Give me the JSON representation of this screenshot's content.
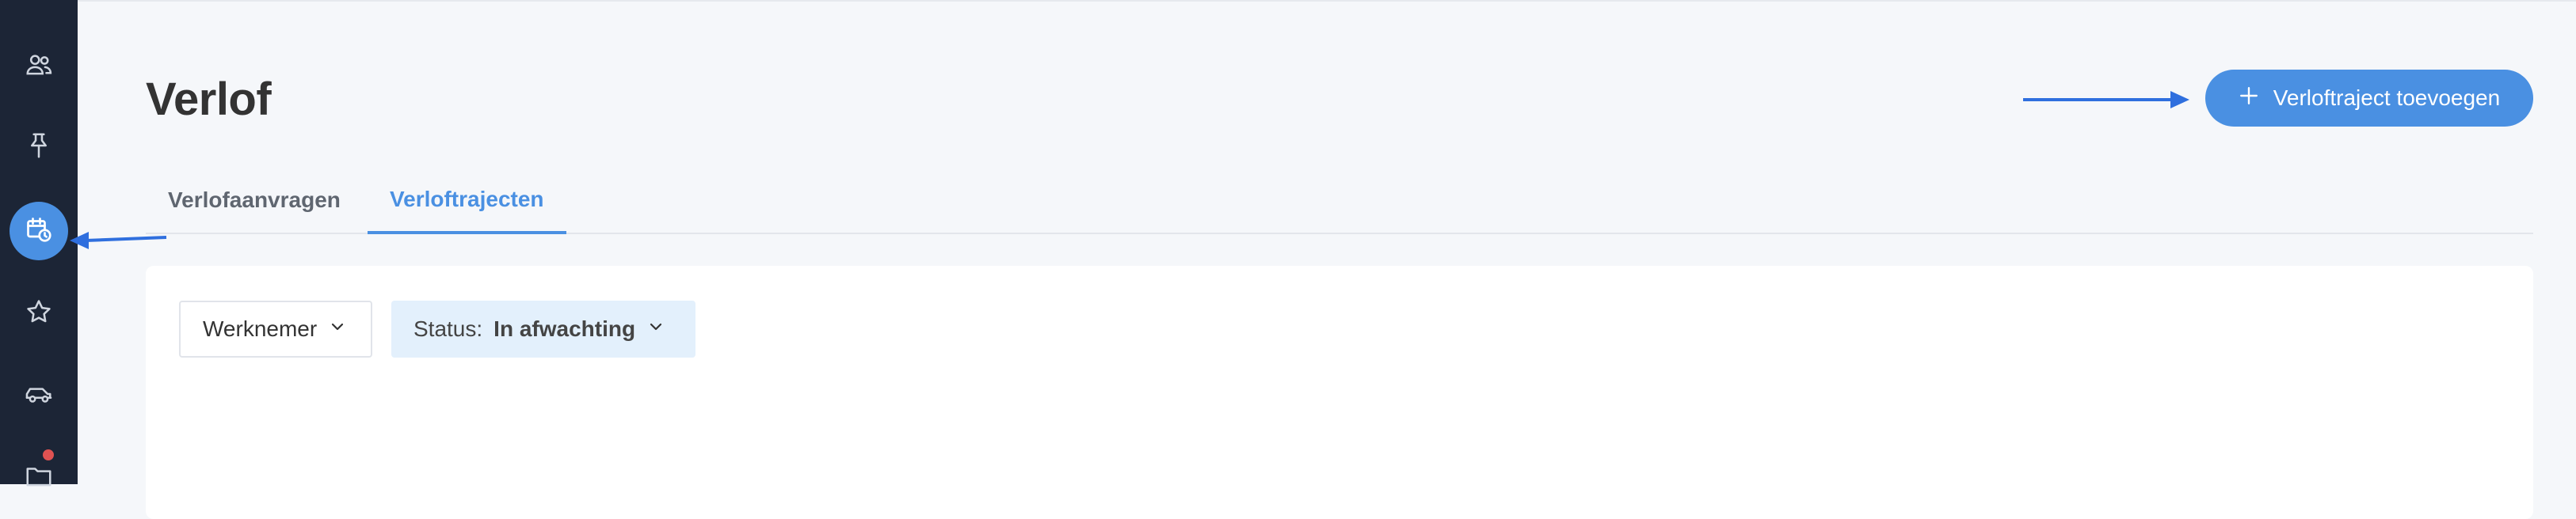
{
  "page": {
    "title": "Verlof"
  },
  "actions": {
    "add_button_label": "Verloftraject toevoegen"
  },
  "tabs": [
    {
      "label": "Verlofaanvragen",
      "active": false
    },
    {
      "label": "Verloftrajecten",
      "active": true
    }
  ],
  "filters": {
    "employee": {
      "label": "Werknemer"
    },
    "status": {
      "label": "Status:",
      "value": "In afwachting"
    }
  },
  "sidebar": {
    "items": [
      {
        "icon": "people-icon"
      },
      {
        "icon": "pin-icon"
      },
      {
        "icon": "calendar-clock-icon",
        "active": true
      },
      {
        "icon": "star-icon"
      },
      {
        "icon": "car-icon"
      },
      {
        "icon": "folder-icon",
        "has_notification": true
      }
    ]
  },
  "colors": {
    "sidebar_bg": "#1c2536",
    "accent": "#4a90e2",
    "notification": "#e05252",
    "page_bg": "#f5f7fa"
  }
}
